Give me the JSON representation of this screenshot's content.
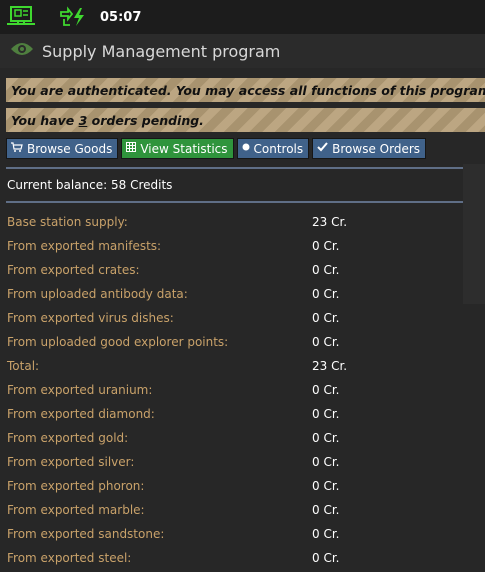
{
  "status_bar": {
    "time": "05:07"
  },
  "window": {
    "title": "Supply Management program"
  },
  "notices": {
    "auth": "You are authenticated. You may access all functions of this program.",
    "orders_prefix": "You have ",
    "orders_count": "3",
    "orders_suffix": " orders pending."
  },
  "buttons": [
    {
      "label": "Browse Goods",
      "icon": "cart-icon"
    },
    {
      "label": "View Statistics",
      "icon": "grid-icon"
    },
    {
      "label": "Controls",
      "icon": "dot-icon"
    },
    {
      "label": "Browse Orders",
      "icon": "check-icon"
    }
  ],
  "balance": "Current balance: 58 Credits",
  "supply_rows": [
    {
      "label": "Base station supply:",
      "value": "23 Cr."
    },
    {
      "label": "From exported manifests:",
      "value": "0 Cr."
    },
    {
      "label": "From exported crates:",
      "value": "0 Cr."
    },
    {
      "label": "From uploaded antibody data:",
      "value": "0 Cr."
    },
    {
      "label": "From exported virus dishes:",
      "value": "0 Cr."
    },
    {
      "label": "From uploaded good explorer points:",
      "value": "0 Cr."
    },
    {
      "label": "Total:",
      "value": "23 Cr."
    },
    {
      "label": "From exported uranium:",
      "value": "0 Cr."
    },
    {
      "label": "From exported diamond:",
      "value": "0 Cr."
    },
    {
      "label": "From exported gold:",
      "value": "0 Cr."
    },
    {
      "label": "From exported silver:",
      "value": "0 Cr."
    },
    {
      "label": "From exported phoron:",
      "value": "0 Cr."
    },
    {
      "label": "From exported marble:",
      "value": "0 Cr."
    },
    {
      "label": "From exported sandstone:",
      "value": "0 Cr."
    },
    {
      "label": "From exported steel:",
      "value": "0 Cr."
    }
  ],
  "colors": {
    "accent_blue": "#40628a",
    "accent_green": "#2f943c",
    "label_tan": "#c9a26a",
    "notice_tan": "#bca682"
  }
}
